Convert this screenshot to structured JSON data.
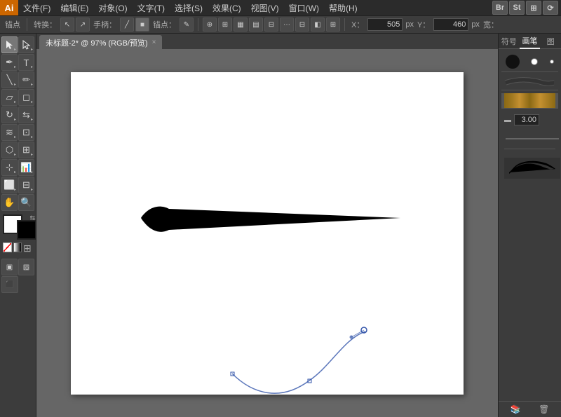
{
  "app": {
    "logo": "Ai",
    "title": "未标题-2*"
  },
  "menubar": {
    "items": [
      "文件(F)",
      "编辑(E)",
      "对象(O)",
      "文字(T)",
      "选择(S)",
      "效果(C)",
      "视图(V)",
      "窗口(W)",
      "帮助(H)"
    ]
  },
  "toolbar": {
    "anchor_label": "锚点",
    "transform_label": "转换：",
    "handle_label": "手柄：",
    "anchor2_label": "锚点：",
    "x_label": "X：",
    "x_value": "505",
    "x_unit": "px",
    "y_label": "Y：",
    "y_value": "460",
    "y_unit": "px",
    "w_label": "宽："
  },
  "tab": {
    "name": "未标题-2* @ 97% (RGB/预览)",
    "close": "×"
  },
  "right_panel": {
    "tabs": [
      "符号",
      "画笔",
      "图"
    ],
    "active_tab": "画笔",
    "brush_size": "3.00"
  },
  "canvas": {
    "zoom": "97%",
    "mode": "RGB/预览"
  }
}
